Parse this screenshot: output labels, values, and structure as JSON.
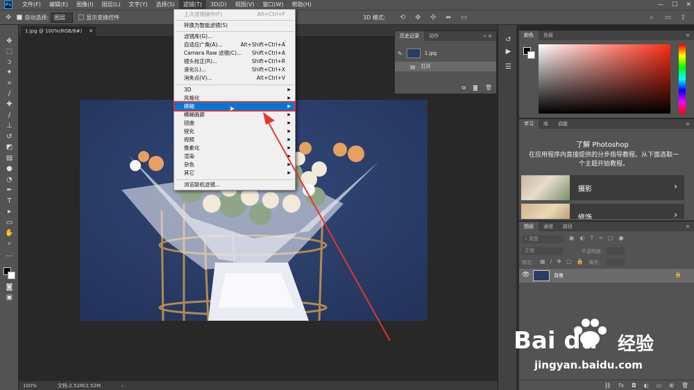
{
  "menubar": {
    "logo": "Ps",
    "items": [
      "文件(F)",
      "编辑(E)",
      "图像(I)",
      "图层(L)",
      "文字(Y)",
      "选择(S)",
      "滤镜(T)",
      "3D(D)",
      "视图(V)",
      "窗口(W)",
      "帮助(H)"
    ]
  },
  "options": {
    "auto_select_label": "自动选择:",
    "auto_select_value": "图层",
    "transform_label": "显示变换控件",
    "mode_3d": "3D 模式:"
  },
  "document": {
    "tab_title": "1.jpg @ 100%(RGB/8#)",
    "zoom": "100%",
    "doc_info": "文档:2.52M/2.52M"
  },
  "filter_menu": {
    "items": [
      {
        "label": "上次滤镜操作(F)",
        "shortcut": "Alt+Ctrl+F",
        "disabled": true
      },
      {
        "label": "转换为智能滤镜(S)",
        "shortcut": ""
      },
      {
        "label": "滤镜库(G)...",
        "shortcut": ""
      },
      {
        "label": "自适应广角(A)...",
        "shortcut": "Alt+Shift+Ctrl+A"
      },
      {
        "label": "Camera Raw 滤镜(C)...",
        "shortcut": "Shift+Ctrl+A"
      },
      {
        "label": "镜头校正(R)...",
        "shortcut": "Shift+Ctrl+R"
      },
      {
        "label": "液化(L)...",
        "shortcut": "Shift+Ctrl+X"
      },
      {
        "label": "消失点(V)...",
        "shortcut": "Alt+Ctrl+V"
      },
      {
        "label": "3D",
        "submenu": true
      },
      {
        "label": "风格化",
        "submenu": true
      },
      {
        "label": "模糊",
        "submenu": true,
        "highlighted": true
      },
      {
        "label": "模糊画廊",
        "submenu": true
      },
      {
        "label": "扭曲",
        "submenu": true
      },
      {
        "label": "锐化",
        "submenu": true
      },
      {
        "label": "视频",
        "submenu": true
      },
      {
        "label": "像素化",
        "submenu": true
      },
      {
        "label": "渲染",
        "submenu": true
      },
      {
        "label": "杂色",
        "submenu": true
      },
      {
        "label": "其它",
        "submenu": true
      },
      {
        "label": "浏览联机滤镜...",
        "shortcut": ""
      }
    ]
  },
  "history_panel": {
    "tabs": [
      "历史记录",
      "动作"
    ],
    "snapshot": "1.jpg",
    "step": "打开"
  },
  "color_panel": {
    "tabs": [
      "颜色",
      "色板"
    ]
  },
  "learn_panel": {
    "tabs": [
      "学习",
      "库",
      "调整"
    ],
    "title": "了解 Photoshop",
    "description": "在应用程序内直接提供的分步指导教程。从下面选取一个主题开始教程。",
    "cards": [
      "摄影",
      "修饰"
    ]
  },
  "layers_panel": {
    "tabs": [
      "图层",
      "通道",
      "路径"
    ],
    "filter_placeholder": "类型",
    "blend_mode": "正常",
    "opacity_label": "不透明度:",
    "lock_label": "锁定:",
    "fill_label": "填充:",
    "layer_name": "背景"
  },
  "watermark": {
    "brand": "Bai du",
    "cn": "经验",
    "url": "jingyan.baidu.com"
  }
}
